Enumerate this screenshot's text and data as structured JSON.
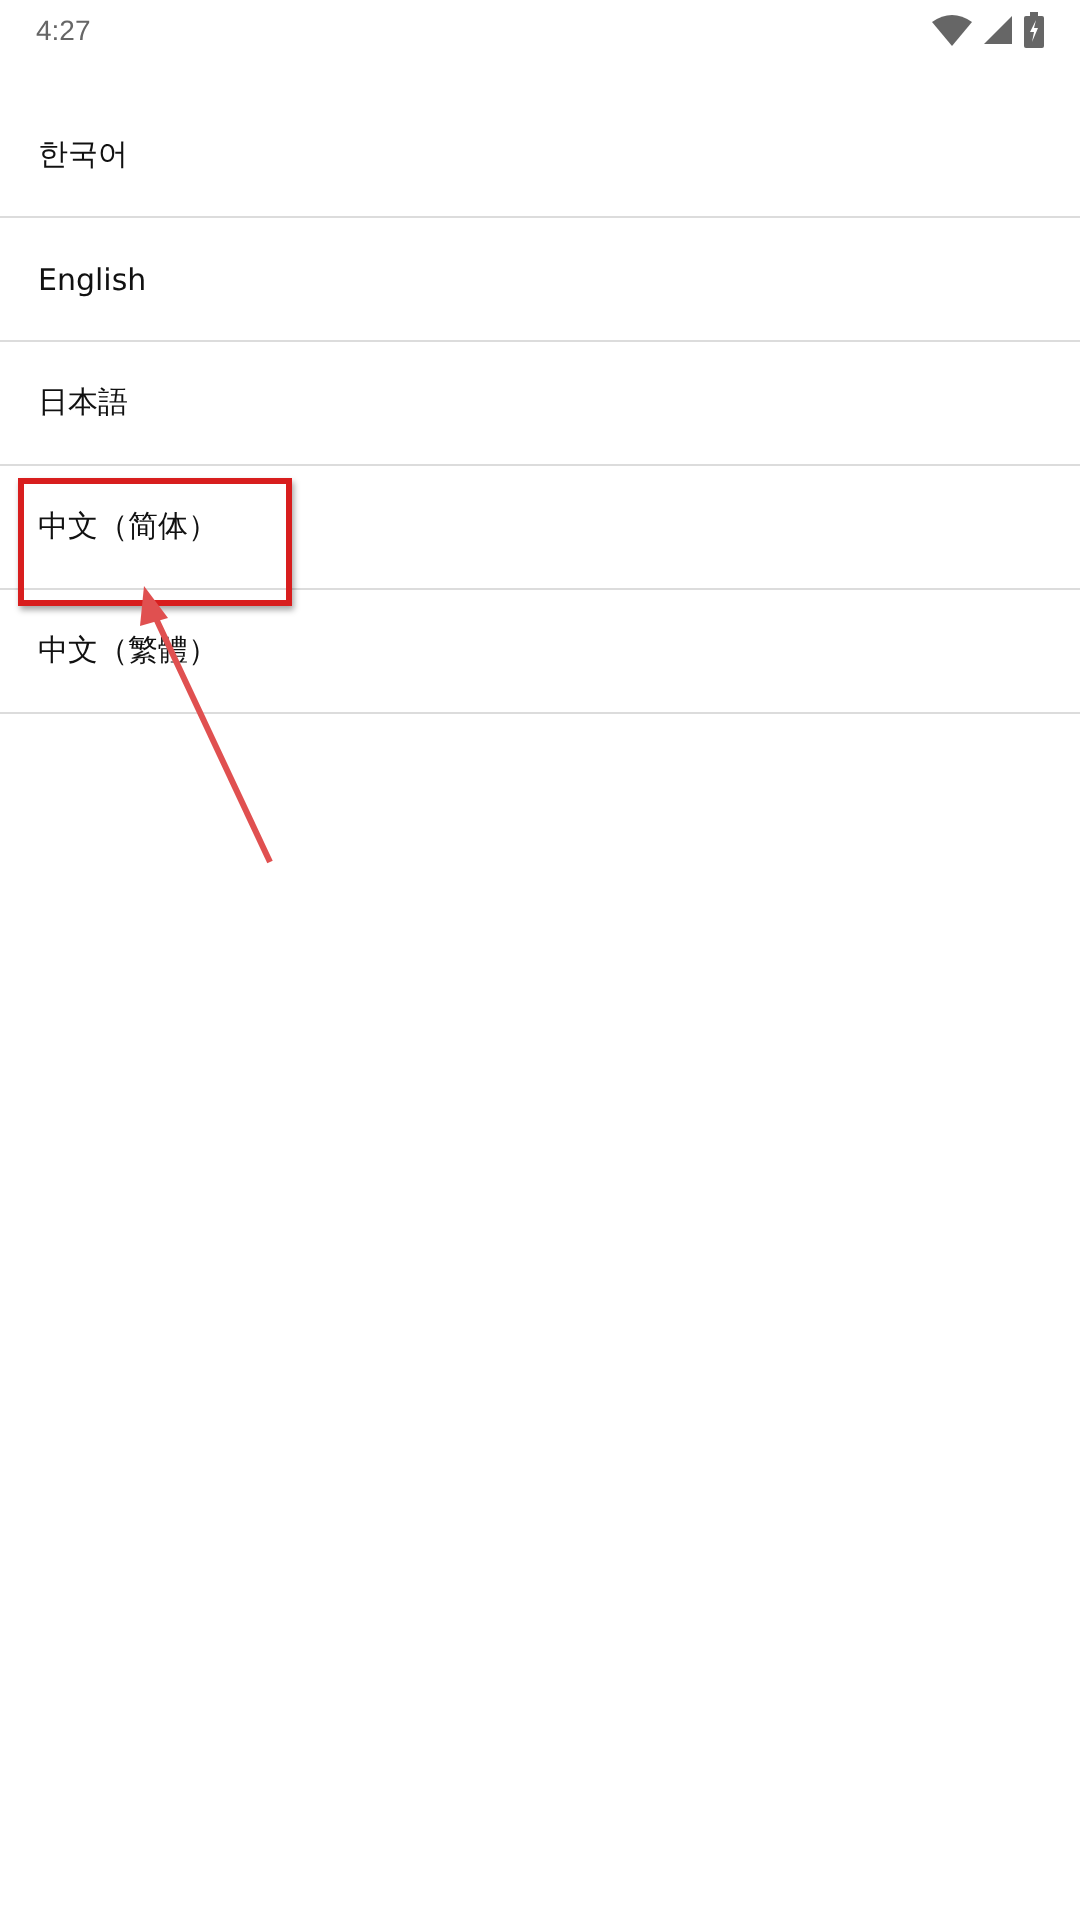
{
  "status_bar": {
    "time": "4:27"
  },
  "languages": [
    {
      "label": "한국어",
      "highlighted": false
    },
    {
      "label": "English",
      "highlighted": false
    },
    {
      "label": "日本語",
      "highlighted": false
    },
    {
      "label": "中文（简体）",
      "highlighted": true
    },
    {
      "label": "中文（繁體）",
      "highlighted": false
    }
  ]
}
